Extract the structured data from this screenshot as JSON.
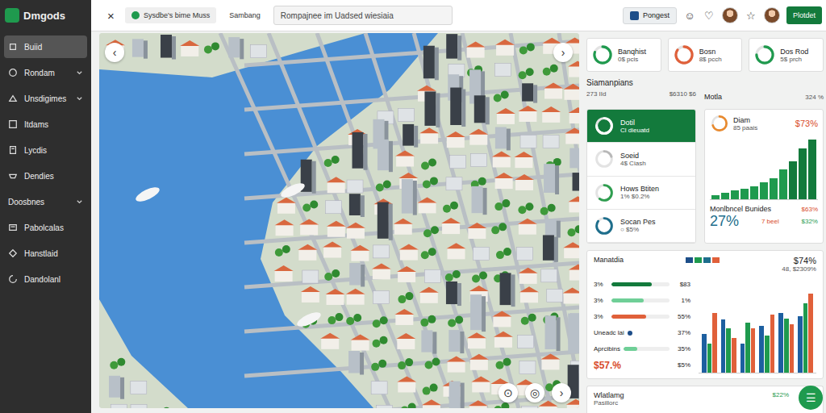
{
  "app": {
    "logo": "Dmgods"
  },
  "sidebar": {
    "items": [
      {
        "label": "Buiid",
        "selected": true,
        "has_submenu": false,
        "kind": "item"
      },
      {
        "label": "Rondam",
        "selected": false,
        "has_submenu": true,
        "kind": "item"
      },
      {
        "label": "Unsdigimes",
        "selected": false,
        "has_submenu": true,
        "kind": "item"
      },
      {
        "label": "Itdams",
        "selected": false,
        "has_submenu": false,
        "kind": "item"
      },
      {
        "label": "Lycdis",
        "selected": false,
        "has_submenu": false,
        "kind": "item"
      },
      {
        "label": "Dendies",
        "selected": false,
        "has_submenu": false,
        "kind": "item"
      },
      {
        "label": "Doosbnes",
        "selected": false,
        "has_submenu": true,
        "kind": "section"
      },
      {
        "label": "Pabolcalas",
        "selected": false,
        "has_submenu": false,
        "kind": "item"
      },
      {
        "label": "Hanstlaid",
        "selected": false,
        "has_submenu": false,
        "kind": "item"
      },
      {
        "label": "Dandolanl",
        "selected": false,
        "has_submenu": false,
        "kind": "item"
      }
    ]
  },
  "topbar": {
    "close": "×",
    "tabs": [
      {
        "label": "Sysdbe's bime Muss",
        "selected": true
      },
      {
        "label": "Sambang",
        "selected": false
      }
    ],
    "search": {
      "placeholder": "Rompajnee im Uadsed wiesiaia"
    },
    "report_button": "Pongest",
    "icons": [
      "☺",
      "♡",
      "☆"
    ],
    "primary_button": "Plotdet"
  },
  "map": {
    "prev": "‹",
    "next": "›",
    "controls": [
      "⊙",
      "◎",
      "›"
    ]
  },
  "stat_cards": [
    {
      "title": "Banqhist",
      "sub": "0$ pcis",
      "color": "#1f9a4e",
      "level": 0.8
    },
    {
      "title": "Bosn",
      "sub": "8$ pcch",
      "color": "#e0603a",
      "level": 0.85
    },
    {
      "title": "Dos Rod",
      "sub": "5$ prch",
      "color": "#1f9a4e",
      "level": 0.75
    }
  ],
  "summary": {
    "title": "Siamanpians",
    "count": "273 IId",
    "amount": "$6310 $6",
    "right_title": "Motla",
    "right_amount": "324 %"
  },
  "list": [
    {
      "title": "Dotil",
      "sub": "Cl dieuatd",
      "selected": true,
      "color": "#ffffff",
      "level": 0.75
    },
    {
      "title": "Soeid",
      "sub": "4$ Ciash",
      "selected": false,
      "color": "#b8b8b8",
      "level": 0.2
    },
    {
      "title": "Hows Btiten",
      "sub": "1% $0.2%",
      "selected": false,
      "color": "#2e9e4f",
      "level": 0.6
    },
    {
      "title": "Socan Pes",
      "sub": "○ $5%",
      "selected": false,
      "color": "#1d6e8c",
      "level": 0.85
    }
  ],
  "growth_card": {
    "title": "Diam",
    "sub": "85 paais",
    "value": "$73%",
    "ring": {
      "color": "#e98a2e",
      "level": 0.7
    },
    "chart": {
      "max": 60,
      "values": [
        4,
        6,
        8,
        10,
        12,
        16,
        20,
        28,
        36,
        48,
        56
      ]
    }
  },
  "monthly": {
    "title": "Monlbncel Bunides",
    "badge": "$63%",
    "big": "27%",
    "sub": "7 beel",
    "value": "$32%"
  },
  "breakdown": {
    "title": "Manatdia",
    "value": "$74%",
    "sub": "48, $2309%",
    "legend": [
      {
        "color": "#1d4e89"
      },
      {
        "color": "#1f9a4e"
      },
      {
        "color": "#1d6e8c"
      },
      {
        "color": "#e0603a"
      }
    ],
    "rows": [
      {
        "kind": "bar",
        "label": "3%",
        "level": 0.7,
        "color": "#137a3c",
        "value": "$83"
      },
      {
        "kind": "bar",
        "label": "3%",
        "level": 0.55,
        "color": "#6fcf97",
        "value": "1%"
      },
      {
        "kind": "bar",
        "label": "3%",
        "level": 0.6,
        "color": "#e0603a",
        "value": "55%"
      },
      {
        "kind": "dot",
        "label": "Uneadc lai",
        "level": 0,
        "color": "#1d4e89",
        "value": "37%"
      },
      {
        "kind": "bar",
        "label": "Aprcibins",
        "level": 0.3,
        "color": "#6fcf97",
        "value": "35%"
      },
      {
        "kind": "total",
        "label": "$57.%",
        "level": 0,
        "color": "#d84b2a",
        "value": "$5%"
      }
    ],
    "chart": {
      "max": 100,
      "series": [
        {
          "color": "#1d5fa0",
          "values": [
            40,
            55,
            30,
            48,
            62,
            58
          ]
        },
        {
          "color": "#1f9a4e",
          "values": [
            30,
            46,
            52,
            38,
            56,
            72
          ]
        },
        {
          "color": "#e0603a",
          "values": [
            62,
            36,
            46,
            60,
            50,
            82
          ]
        }
      ]
    }
  },
  "footer_card": {
    "title": "Wlatlamg",
    "sub": "Pasillorc",
    "value": "$22%"
  },
  "fab": "☰"
}
